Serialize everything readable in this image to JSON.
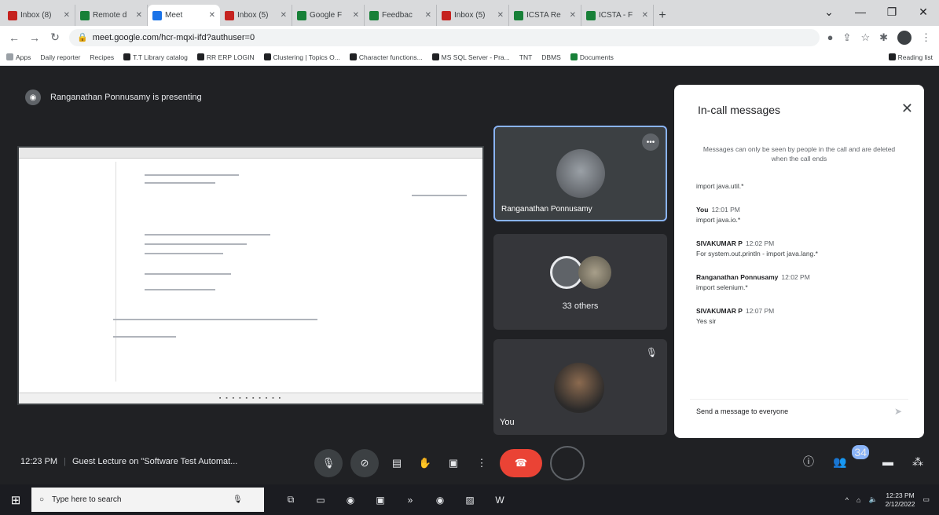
{
  "browser": {
    "tabs": [
      {
        "label": "Inbox (8)",
        "favicon": "gmail"
      },
      {
        "label": "Remote d",
        "favicon": "sheets"
      },
      {
        "label": "Meet",
        "favicon": "meet",
        "active": true
      },
      {
        "label": "Inbox (5)",
        "favicon": "gmail"
      },
      {
        "label": "Google F",
        "favicon": "sheets"
      },
      {
        "label": "Feedbac",
        "favicon": "sheets"
      },
      {
        "label": "Inbox (5)",
        "favicon": "gmail"
      },
      {
        "label": "ICSTA Re",
        "favicon": "sheets"
      },
      {
        "label": "ICSTA - F",
        "favicon": "sheets"
      }
    ],
    "new_tab": "+",
    "url": "meet.google.com/hcr-mqxi-ifd?authuser=0",
    "bookmarks": [
      "Apps",
      "Daily reporter",
      "Recipes",
      "T.T Library catalog",
      "RR ERP LOGIN",
      "Clustering | Topics O...",
      "Character functions...",
      "MS SQL Server - Pra...",
      "TNT",
      "DBMS",
      "Documents"
    ],
    "reading_list": "Reading list"
  },
  "meet": {
    "presenting": "Ranganathan Ponnusamy is presenting",
    "participants": {
      "featured": "Ranganathan Ponnusamy",
      "others": "33 others",
      "self": "You"
    },
    "bottom": {
      "time": "12:23 PM",
      "title": "Guest Lecture on \"Software Test Automat...",
      "people_count": "34"
    },
    "panel": {
      "title": "In-call messages",
      "note": "Messages can only be seen by people in the call and are deleted when the call ends",
      "messages": [
        {
          "sender": "",
          "time": "",
          "text": "import java.util.*"
        },
        {
          "sender": "You",
          "time": "12:01 PM",
          "text": "import java.io.*"
        },
        {
          "sender": "SIVAKUMAR P",
          "time": "12:02 PM",
          "text": "For system.out.println - import java.lang.*"
        },
        {
          "sender": "Ranganathan Ponnusamy",
          "time": "12:02 PM",
          "text": "import selenium.*"
        },
        {
          "sender": "SIVAKUMAR P",
          "time": "12:07 PM",
          "text": "Yes sir"
        }
      ],
      "compose_placeholder": "Send a message to everyone"
    }
  },
  "taskbar": {
    "search_placeholder": "Type here to search",
    "time": "12:23 PM",
    "date": "2/12/2022"
  },
  "colors": {
    "end_call": "#ea4335",
    "accent": "#8ab4f8",
    "stage": "#202124"
  }
}
